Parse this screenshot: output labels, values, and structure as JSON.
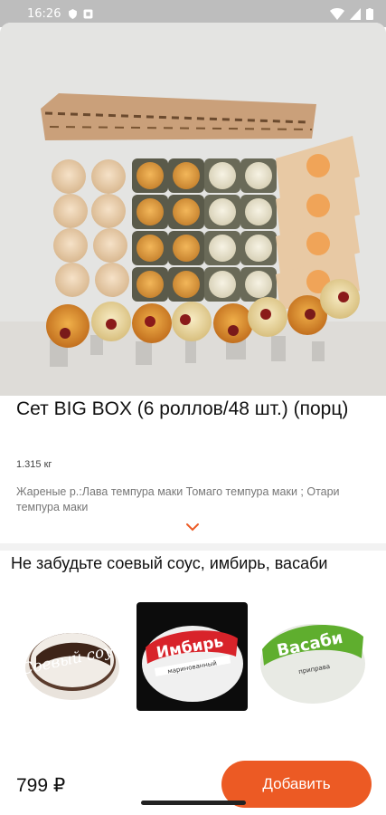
{
  "status": {
    "time": "16:26"
  },
  "product": {
    "title": "Сет BIG BOX (6 роллов/48 шт.) (порц)",
    "weight": "1.315 кг",
    "description": "Жареные р.:Лава темпура маки Томаго темпура маки ; Отари темпура маки"
  },
  "extras": {
    "title": "Не забудьте соевый соус, имбирь, васаби",
    "items": [
      {
        "name": "Соевый соус",
        "label": "Соевый\nсоус"
      },
      {
        "name": "Имбирь",
        "label": "Имбирь",
        "sub": "маринованный"
      },
      {
        "name": "Васаби",
        "label": "Васаби",
        "sub": "приправа"
      }
    ]
  },
  "footer": {
    "price": "799 ₽",
    "add_label": "Добавить"
  },
  "colors": {
    "accent": "#ec5a24",
    "status_bar": "#bdbdbd"
  }
}
